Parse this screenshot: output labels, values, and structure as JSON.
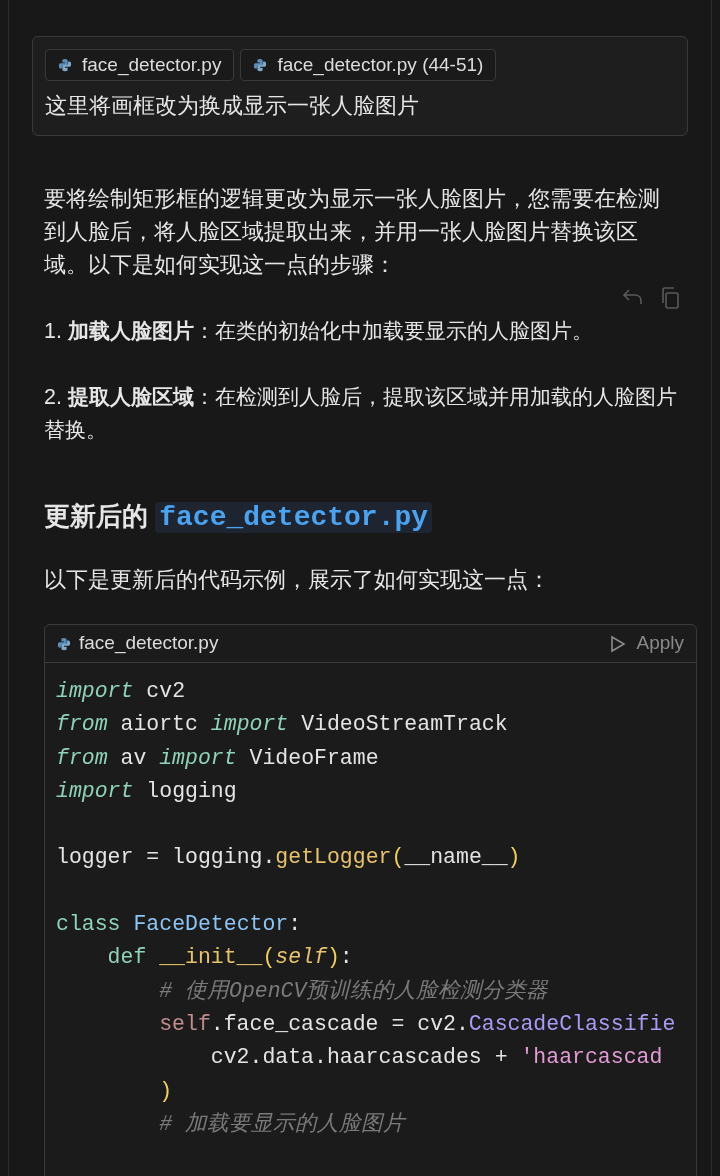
{
  "prompt": {
    "chips": [
      {
        "label": "face_detector.py"
      },
      {
        "label": "face_detector.py (44-51)"
      }
    ],
    "text": "这里将画框改为换成显示一张人脸图片"
  },
  "answer": {
    "intro": "要将绘制矩形框的逻辑更改为显示一张人脸图片，您需要在检测到人脸后，将人脸区域提取出来，并用一张人脸图片替换该区域。以下是如何实现这一点的步骤：",
    "steps": [
      "1. **加载人脸图片**：在类的初始化中加载要显示的人脸图片。",
      "2. **提取人脸区域**：在检测到人脸后，提取该区域并用加载的人脸图片替换。"
    ],
    "heading": {
      "text": "更新后的 ",
      "code": "face_detector.py"
    },
    "lead": "以下是更新后的代码示例，展示了如何实现这一点：",
    "code_block": {
      "filename": "face_detector.py",
      "action": "Apply",
      "sections": [
        [
          {
            "tokens": [
              {
                "kind": "keyword",
                "text": "import"
              },
              {
                "kind": "plain",
                "text": " cv2"
              }
            ]
          },
          {
            "tokens": [
              {
                "kind": "keyword",
                "text": "from"
              },
              {
                "kind": "plain",
                "text": " aiortc "
              },
              {
                "kind": "keyword",
                "text": "import"
              },
              {
                "kind": "plain",
                "text": " VideoStreamTrack"
              }
            ]
          },
          {
            "tokens": [
              {
                "kind": "keyword",
                "text": "from"
              },
              {
                "kind": "plain",
                "text": " av "
              },
              {
                "kind": "keyword",
                "text": "import"
              },
              {
                "kind": "plain",
                "text": " VideoFrame"
              }
            ]
          },
          {
            "tokens": [
              {
                "kind": "keyword",
                "text": "import"
              },
              {
                "kind": "plain",
                "text": " logging"
              }
            ]
          }
        ],
        [
          {
            "tokens": [
              {
                "kind": "plain",
                "text": "logger = logging."
              },
              {
                "kind": "func",
                "text": "getLogger"
              },
              {
                "kind": "paren",
                "text": "("
              },
              {
                "kind": "plain",
                "text": "__name__"
              },
              {
                "kind": "paren",
                "text": ")"
              }
            ]
          }
        ],
        [
          {
            "tokens": [
              {
                "kind": "decl",
                "text": "class "
              },
              {
                "kind": "type",
                "text": "FaceDetector"
              },
              {
                "kind": "plain",
                "text": ":"
              }
            ],
            "children": [
              {
                "tokens": [
                  {
                    "kind": "decl",
                    "text": "def "
                  },
                  {
                    "kind": "func",
                    "text": "__init__"
                  },
                  {
                    "kind": "paren",
                    "text": "("
                  },
                  {
                    "kind": "param",
                    "text": "self"
                  },
                  {
                    "kind": "paren",
                    "text": ")"
                  },
                  {
                    "kind": "plain",
                    "text": ":"
                  }
                ],
                "children": [
                  {
                    "tokens": [
                      {
                        "kind": "comment",
                        "text": "# 使用OpenCV预训练的人脸检测分类器"
                      }
                    ]
                  },
                  {
                    "tokens": [
                      {
                        "kind": "self",
                        "text": "self"
                      },
                      {
                        "kind": "plain",
                        "text": ".face_cascade = cv2."
                      },
                      {
                        "kind": "method",
                        "text": "CascadeClassifie"
                      }
                    ],
                    "children": [
                      {
                        "tokens": [
                          {
                            "kind": "plain",
                            "text": "cv2.data.haarcascades + "
                          },
                          {
                            "kind": "string",
                            "text": "'haarcascad"
                          }
                        ]
                      }
                    ]
                  },
                  {
                    "tokens": [
                      {
                        "kind": "paren",
                        "text": ")"
                      }
                    ]
                  },
                  {
                    "tokens": [
                      {
                        "kind": "comment",
                        "text": "# 加载要显示的人脸图片"
                      }
                    ]
                  }
                ]
              }
            ]
          }
        ]
      ]
    }
  }
}
